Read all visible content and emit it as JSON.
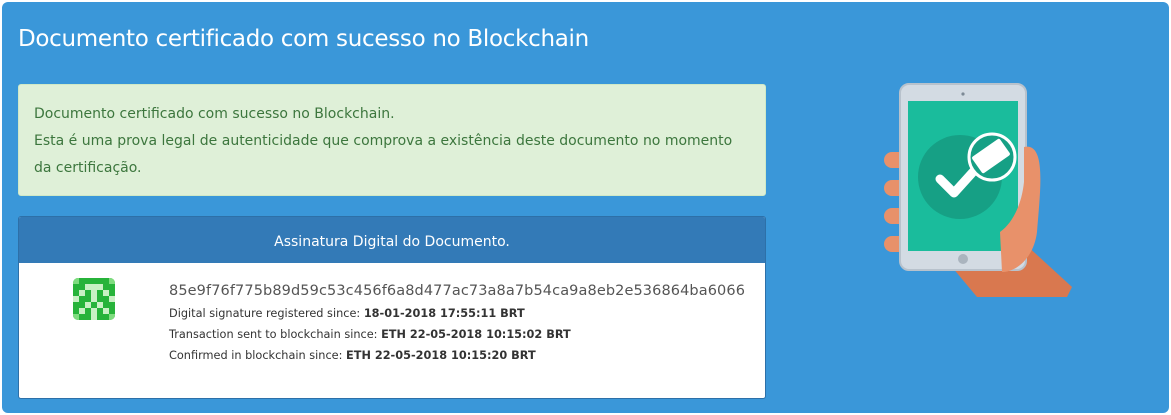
{
  "panel": {
    "title": "Documento certificado com sucesso no Blockchain"
  },
  "alert": {
    "line1": "Documento certificado com sucesso no Blockchain.",
    "line2": "Esta é uma prova legal de autenticidade que comprova a existência deste documento no momento da certificação."
  },
  "signature": {
    "header": "Assinatura Digital do Documento.",
    "hash": "85e9f76f775b89d59c53c456f6a8d477ac73a8a7b54ca9a8eb2e536864ba6066",
    "registered_label": "Digital signature registered since:",
    "registered_value": "18-01-2018 17:55:11 BRT",
    "sent_label": "Transaction sent to blockchain since:",
    "sent_value": "ETH 22-05-2018 10:15:02 BRT",
    "confirmed_label": "Confirmed in blockchain since:",
    "confirmed_value": "ETH 22-05-2018 10:15:20 BRT"
  },
  "colors": {
    "panel_bg": "#3a97d9",
    "alert_bg": "#dff0d8",
    "alert_text": "#3c763d",
    "header_bg": "#337ab7",
    "identicon_green": "#27b33a",
    "screen_teal": "#1abc9c"
  },
  "icons": {
    "identicon": "identicon",
    "illustration": "phone-checkmark-illustration"
  }
}
